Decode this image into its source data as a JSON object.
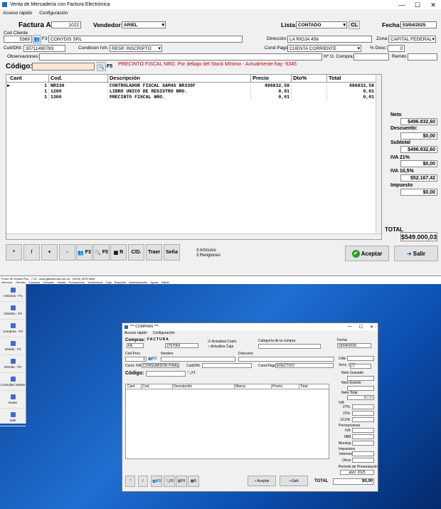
{
  "top_window": {
    "title": "Venta de Mercadería con Factura Electrónica",
    "controls": {
      "minimize": "—",
      "maximize": "☐",
      "close": "✕"
    },
    "menu": [
      "Acceso rápido",
      "Configuración"
    ],
    "factura_label": "Factura A",
    "factura_num": "1022",
    "vendedor_label": "Vendedor:",
    "vendedor": "ARIEL",
    "lista_label": "Lista:",
    "lista": "CONTADO",
    "cl_button": "CL",
    "fecha_label": "Fecha:",
    "fecha": "03/04/2025",
    "cod_cliente_label": "Cod Cliente",
    "cod_cliente": "5369",
    "f3_label": "F3",
    "cliente_nombre": "CONYDIS SRL",
    "direccion_label": "Dirección:",
    "direccion": "LA RIOJA 456",
    "zona_label": "Zona:",
    "zona": "CAPITAL FEDERAL",
    "cuit_label": "Cuit/DNI:",
    "cuit": "30711490783",
    "condicion_iva_label": "Condicion IVA:",
    "condicion_iva": "RESP. INSCRIPTO",
    "cond_pago_label": "Cond Pago:",
    "cond_pago": "CUENTA CORRIENTE",
    "desc_label": "% Desc:",
    "desc": "0",
    "observaciones_label": "Observaciones:",
    "n_compra_label": "Nº O. Compra:",
    "remito_label": "Remito",
    "codigo_label": "Código:",
    "f5_label": "F5",
    "stock_warning": "PRECINTO FISCAL NRO. Por debajo del Stock Mínimo - Actualmente hay -5345",
    "columns": [
      "Cant",
      "Cod.",
      "Descripción",
      "Precio",
      "Dto%",
      "Total"
    ],
    "rows": [
      {
        "cant": "1",
        "cod": "NR330",
        "desc": "CONTROLADOR FISCAL SAM4S NR330F",
        "precio": "496832,58",
        "dto": "",
        "total": "496832,58"
      },
      {
        "cant": "1",
        "cod": "1200",
        "desc": "LIBRO UNICO DE REGISTRO NRO.",
        "precio": "0,01",
        "dto": "",
        "total": "0,01"
      },
      {
        "cant": "1",
        "cod": "1300",
        "desc": "PRECINTO FISCAL NRO.",
        "precio": "0,01",
        "dto": "",
        "total": "0,01"
      }
    ],
    "totals": {
      "neto_label": "Neto",
      "neto": "$496.832,60",
      "descuento_label": "Descuento:",
      "descuento": "$0,00",
      "subtotal_label": "Subtotal",
      "subtotal": "$496.832,60",
      "iva21_label": "IVA 21%",
      "iva21": "$0,00",
      "iva105_label": "IVA 10,5%",
      "iva105": "$52.167,42",
      "impuesto_label": "Impuesto",
      "impuesto": "$0,00",
      "total_label": "TOTAL",
      "total": "$549.000,03"
    },
    "toolbar": {
      "mult": "*",
      "div": "/",
      "plus": "+",
      "minus": "-",
      "f3": "F3",
      "f5": "F5",
      "r": "R",
      "cd": "C/D.",
      "traer": "Traer",
      "sena": "Seña",
      "articulos": "3 Artículos",
      "renglones": "3 Renglones",
      "aceptar": "Aceptar",
      "salir": "Salir"
    }
  },
  "desktop": {
    "app_title": "Punto de Ventas Plus - 7.40 - www.gdsistemas.com.ar - (3415) 4575 5840",
    "menu": [
      "Artículos",
      "Clientes",
      "Compras",
      "Cheques",
      "Ventas",
      "Proveedores",
      "Vendedores",
      "Caja",
      "Reportes",
      "Administración",
      "Ayuda",
      "Salida"
    ],
    "sidebar": [
      "Artículos - F1",
      "Clientes - F2",
      "Compras - F3",
      "Ventas - F4",
      "Remito - F5",
      "Consultar Ventas",
      "Notas",
      "Salir"
    ]
  },
  "compras_window": {
    "title": "*** COMPRAS ***",
    "controls": {
      "minimize": "—",
      "maximize": "☐",
      "close": "✕"
    },
    "menu": [
      "Acceso rápido",
      "Configuración"
    ],
    "compras_label": "Compras:",
    "factura_label": "FACTURA",
    "tipo": "FA",
    "numero": "2767062",
    "actualiza_costo": "Actualiza Costo",
    "actualiza_caja": "Actualiza Caja",
    "categoria_label": "Categoría de la compra",
    "fecha_label": "Fecha",
    "fecha": "03/04/2025",
    "cod_prov_label": "Cód Prov.",
    "cod_prov": "1",
    "f3_label": "F3",
    "nombre_label": "Nombre",
    "direccion_label": "Dirección",
    "cond_iva_label": "Cond. IVA",
    "cond_iva": "CONSUMIDOR FINAL",
    "cuit_label": "Cuit/DNI",
    "cond_pago_label": "Cond.Pago",
    "cond_pago": "EFECTIVO",
    "cae_label": "CAE",
    "venc_cae_label": "Venc. CAE",
    "venc_cae": "/ /",
    "codigo_label": "Código:",
    "f1_label": "F1",
    "columns": [
      "Cant",
      "Cod.",
      "Descripción",
      "Marca",
      "Precio",
      "Total"
    ],
    "side": {
      "neto_gravado": "Neto Gravado",
      "neto_exento": "Neto Exento",
      "neto_total": "Neto Total",
      "neto_total_val": "$0,00",
      "iva": "IVA",
      "iva27": "27%",
      "iva21": "21%",
      "iva105": "10,5%",
      "percepciones": "Percepciones",
      "p_iva": "IVA",
      "p_iibb": "IIBB",
      "p_munic": "Municip.",
      "impuestos": "Impuestos",
      "internos": "Internos",
      "otros": "Otros",
      "periodo": "Período de Presentación",
      "mes": "abril",
      "anio": "2025"
    },
    "toolbar": {
      "mult": "*",
      "div": "/",
      "f3": "F3",
      "f5": "F5",
      "f9": "F9",
      "r": "R",
      "aceptar": "Aceptar",
      "salir": "Salir"
    },
    "total_label": "TOTAL",
    "total": "$0,00"
  }
}
